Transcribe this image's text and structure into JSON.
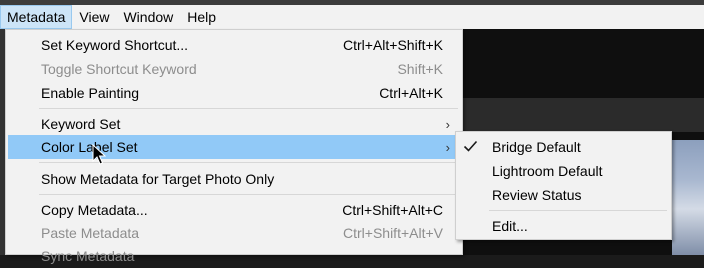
{
  "menubar": {
    "items": [
      {
        "label": "Metadata",
        "active": true
      },
      {
        "label": "View",
        "active": false
      },
      {
        "label": "Window",
        "active": false
      },
      {
        "label": "Help",
        "active": false
      }
    ]
  },
  "main_menu": {
    "items": [
      {
        "label": "Set Keyword Shortcut...",
        "shortcut": "Ctrl+Alt+Shift+K",
        "enabled": true
      },
      {
        "label": "Toggle Shortcut Keyword",
        "shortcut": "Shift+K",
        "enabled": false
      },
      {
        "label": "Enable Painting",
        "shortcut": "Ctrl+Alt+K",
        "enabled": true
      },
      {
        "label": "Keyword Set",
        "submenu": true,
        "enabled": true
      },
      {
        "label": "Color Label Set",
        "submenu": true,
        "enabled": true,
        "highlighted": true
      },
      {
        "label": "Show Metadata for Target Photo Only",
        "enabled": true
      },
      {
        "label": "Copy Metadata...",
        "shortcut": "Ctrl+Shift+Alt+C",
        "enabled": true
      },
      {
        "label": "Paste Metadata",
        "shortcut": "Ctrl+Shift+Alt+V",
        "enabled": false
      },
      {
        "label": "Sync Metadata",
        "enabled": false
      }
    ]
  },
  "submenu": {
    "items": [
      {
        "label": "Bridge Default",
        "checked": true
      },
      {
        "label": "Lightroom Default",
        "checked": false
      },
      {
        "label": "Review Status",
        "checked": false
      },
      {
        "label": "Edit...",
        "checked": false
      }
    ]
  },
  "icons": {
    "submenu_arrow": "chevron-right-icon",
    "check": "checkmark-icon",
    "cursor": "mouse-pointer-icon"
  },
  "colors": {
    "menu_bg": "#f2f2f2",
    "highlight": "#91c9f7",
    "active_menu": "#cce4f7",
    "disabled_text": "#8d8d8d"
  }
}
